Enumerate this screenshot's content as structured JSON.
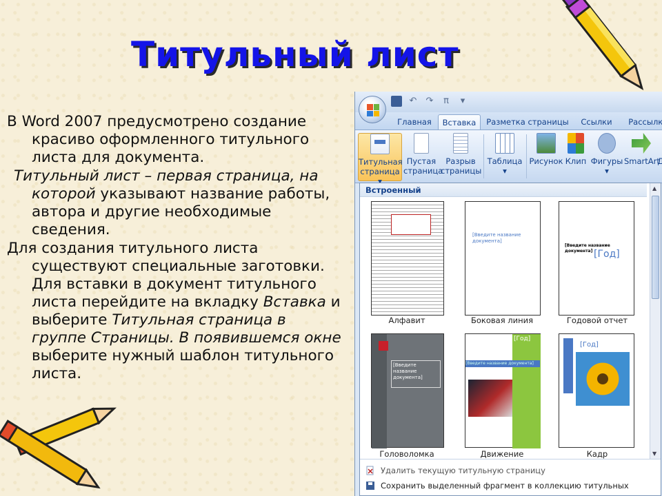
{
  "slide": {
    "title": "Титульный лист",
    "para1": "В Word 2007 предусмотрено создание красиво оформленного титульного листа для документа.",
    "para2_italic1": "Титульный лист – первая страница, на которой",
    "para2_rest": " указывают название работы, автора и другие необходимые сведения.",
    "para3_a": "Для создания титульного листа существуют специальные заготовки. Для вставки в документ титульного листа перейдите на вкладку ",
    "para3_it1": "Вставка",
    "para3_b": " и ",
    "para3_bold1": "выберите",
    "para3_it2": " Титульная страница в группе Страницы. В появившемся окне",
    "para3_c": " выберите нужный шаблон титульного листа."
  },
  "word": {
    "tabs": [
      "Главная",
      "Вставка",
      "Разметка страницы",
      "Ссылки",
      "Рассылки"
    ],
    "ribbon": {
      "cover": "Титульная страница",
      "blank": "Пустая страница",
      "break": "Разрыв страницы",
      "table": "Таблица",
      "picture": "Рисунок",
      "clip": "Клип",
      "shapes": "Фигуры",
      "smartart": "SmartArt",
      "chart_partial": "Д"
    },
    "gallery_header": "Встроенный",
    "templates": [
      "Алфавит",
      "Боковая линия",
      "Годовой отчет",
      "Головоломка",
      "Движение",
      "Кадр"
    ],
    "menu": {
      "remove": "Удалить текущую титульную страницу",
      "save": "Сохранить выделенный фрагмент в коллекцию титульных страниц..."
    },
    "thumb_text": {
      "enter_title": "[Введите название документа]",
      "enter_title_short": "[Введите название",
      "doc": "документа]",
      "year": "[Год]",
      "bracket_year": "[Год]"
    }
  },
  "colors": {
    "title_blue": "#1414e8",
    "background": "#f7efd9",
    "office_blue": "#15428b"
  }
}
